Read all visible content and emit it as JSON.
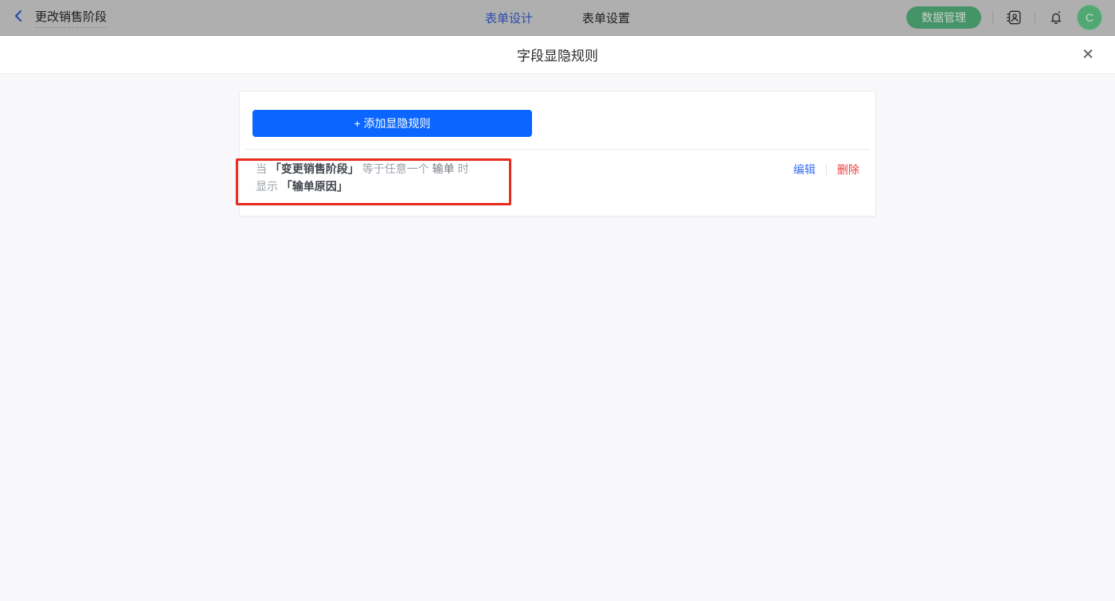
{
  "topbar": {
    "back_label": "更改销售阶段",
    "tabs": [
      {
        "label": "表单设计",
        "active": true
      },
      {
        "label": "表单设置",
        "active": false
      }
    ],
    "data_manage_label": "数据管理",
    "avatar_letter": "C",
    "icons": {
      "back": "chevron-left",
      "contacts": "address-book",
      "notifications": "bell-with-dot"
    }
  },
  "modal": {
    "title": "字段显隐规则",
    "close_glyph": "✕",
    "add_button_label": "+ 添加显隐规则",
    "rule": {
      "condition_prefix": "当",
      "condition_field": "「变更销售阶段」",
      "condition_operator": "等于任意一个",
      "condition_value": "输单",
      "condition_suffix": "时",
      "action_prefix": "显示",
      "action_field": "「输单原因」",
      "edit_label": "编辑",
      "delete_label": "删除"
    }
  },
  "colors": {
    "accent_blue": "#0a66ff",
    "link_blue": "#3a6ff2",
    "delete_red": "#f03b3b",
    "annotation_red": "#e72c1e",
    "topbar_green": "#449468",
    "dimmed_bar_bg": "#afafaf"
  }
}
